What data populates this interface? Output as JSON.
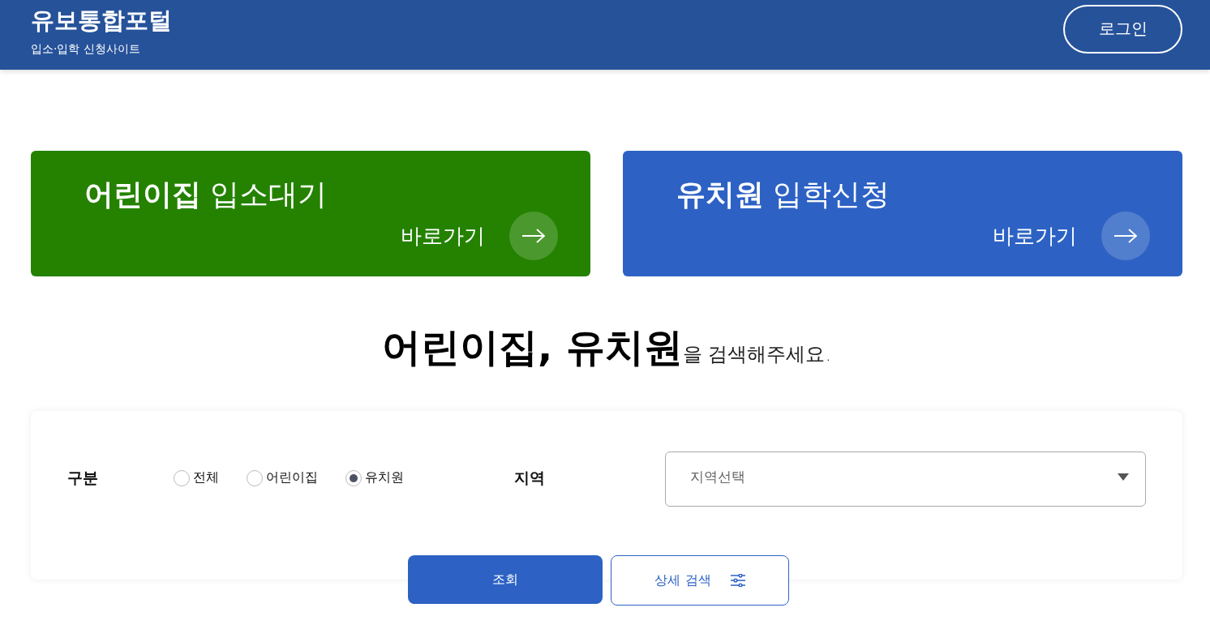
{
  "header": {
    "title": "유보통합포털",
    "subtitle": "입소·입학 신청사이트",
    "login": "로그인"
  },
  "cards": [
    {
      "bold": "어린이집",
      "rest": "입소대기",
      "link": "바로가기",
      "color": "#248200"
    },
    {
      "bold": "유치원",
      "rest": "입학신청",
      "link": "바로가기",
      "color": "#2d62c4"
    }
  ],
  "heading": "**어린이집, 유치원**을 검색해주세요.",
  "search": {
    "type_label": "구분",
    "options": [
      {
        "label": "전체",
        "selected": false
      },
      {
        "label": "어린이집",
        "selected": false
      },
      {
        "label": "유치원",
        "selected": true
      }
    ],
    "region_label": "지역",
    "region": {
      "placeholder": "지역선택"
    }
  },
  "buttons": {
    "search": "조회",
    "detail": "상세 검색"
  }
}
